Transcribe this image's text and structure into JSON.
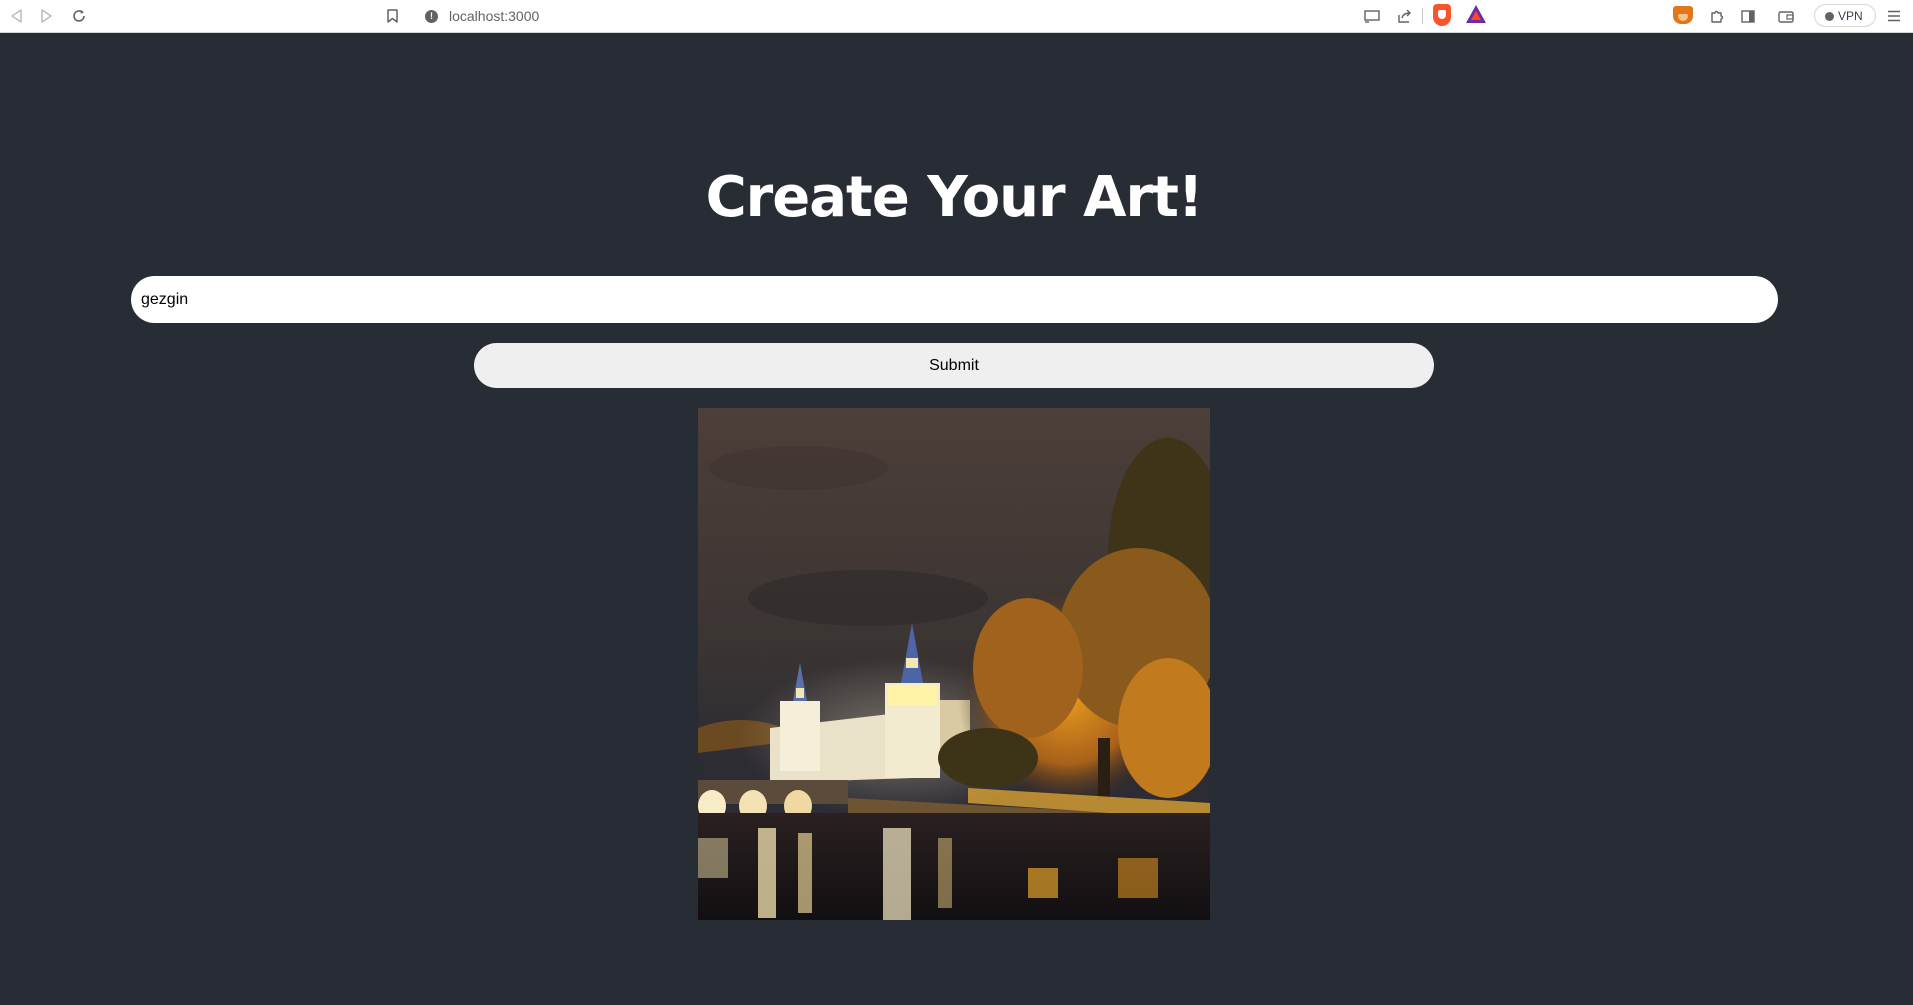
{
  "browser": {
    "url": "localhost:3000",
    "vpn_label": "VPN",
    "icons": {
      "back": "back-arrow-icon",
      "forward": "forward-arrow-icon",
      "reload": "reload-icon",
      "bookmark": "bookmark-icon",
      "site_info": "info-icon",
      "cast": "cast-icon",
      "share": "share-icon",
      "brave_shields": "brave-lion-icon",
      "rewards": "bat-triangle-icon",
      "metamask": "fox-extension-icon",
      "extensions": "puzzle-icon",
      "sidebar": "sidebar-icon",
      "wallet": "wallet-icon",
      "menu": "hamburger-menu-icon"
    }
  },
  "page": {
    "title": "Create Your Art!",
    "prompt": {
      "value": "gezgin",
      "placeholder": ""
    },
    "submit_label": "Submit"
  },
  "colors": {
    "page_background": "#282c34",
    "title": "#ffffff",
    "input_background": "#ffffff",
    "button_background": "#efefef"
  }
}
